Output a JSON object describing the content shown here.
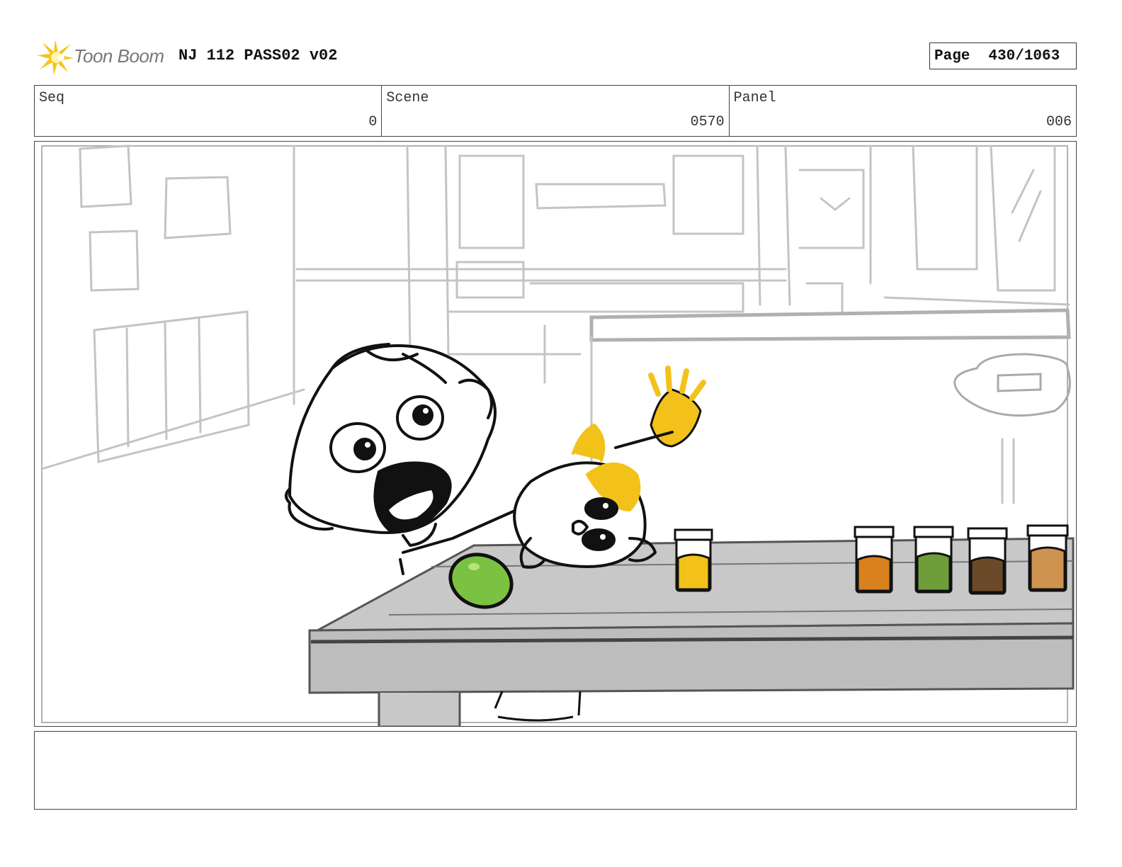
{
  "header": {
    "logo_text": "Toon Boom",
    "project_title": "NJ 112 PASS02 v02",
    "page_label": "Page",
    "page_number": "430/1063"
  },
  "info": {
    "seq_label": "Seq",
    "seq_value": "0",
    "scene_label": "Scene",
    "scene_value": "0570",
    "panel_label": "Panel",
    "panel_value": "006"
  },
  "notes": {
    "text": ""
  },
  "colors": {
    "logo_star": "#f5c518",
    "jar_yellow": "#f2c21a",
    "jar_orange": "#d9801f",
    "jar_green": "#6f9d3a",
    "jar_brown": "#6b4a2a",
    "jar_tan": "#cf9350",
    "lime": "#7cc242",
    "table": "#c8c8c8"
  }
}
